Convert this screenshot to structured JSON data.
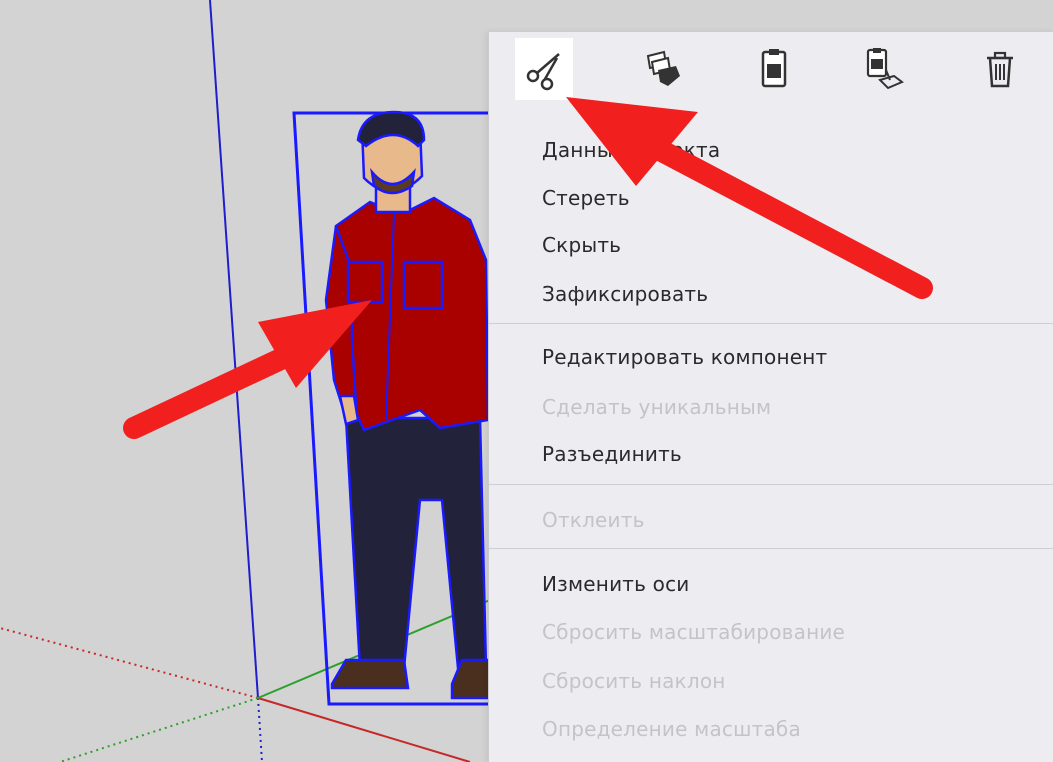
{
  "toolbar": {
    "tools": [
      {
        "icon": "scissors-icon",
        "label": "cut"
      },
      {
        "icon": "copy-icon",
        "label": "copy"
      },
      {
        "icon": "paste-icon",
        "label": "paste"
      },
      {
        "icon": "paste-in-place-icon",
        "label": "paste in place"
      },
      {
        "icon": "trash-icon",
        "label": "delete"
      }
    ],
    "active_tool": "scissors-icon"
  },
  "menu": {
    "items": [
      {
        "label": "Данные объекта",
        "enabled": true
      },
      {
        "label": "Стереть",
        "enabled": true
      },
      {
        "label": "Скрыть",
        "enabled": true
      },
      {
        "label": "Зафиксировать",
        "enabled": true
      },
      {
        "label": "Редактировать компонент",
        "enabled": true
      },
      {
        "label": "Сделать уникальным",
        "enabled": false
      },
      {
        "label": "Разъединить",
        "enabled": true
      },
      {
        "label": "Отклеить",
        "enabled": false
      },
      {
        "label": "Изменить оси",
        "enabled": true
      },
      {
        "label": "Сбросить масштабирование",
        "enabled": false
      },
      {
        "label": "Сбросить наклон",
        "enabled": false
      },
      {
        "label": "Определение масштаба",
        "enabled": false
      }
    ]
  },
  "colors": {
    "viewport_bg": "#d3d3d3",
    "menu_bg": "#ededf1",
    "selection_blue": "#1a1aff",
    "arrow_red": "#f21f1f",
    "shirt_red": "#a90000",
    "pants_navy": "#22223a",
    "skin": "#e8b98b",
    "axis_green": "#2ca02c",
    "axis_red": "#c62828",
    "axis_blue": "#1e1ecc",
    "disabled_text": "#c4c4c8"
  }
}
